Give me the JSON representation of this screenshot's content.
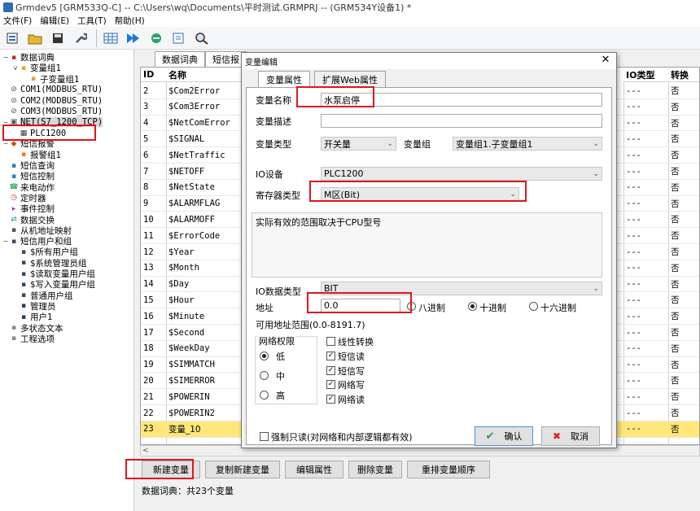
{
  "window": {
    "title": "Grmdev5 [GRM533Q-C]  -- C:\\Users\\wq\\Documents\\平时测试.GRMPRJ -- (GRM534Y设备1) *"
  },
  "menu": [
    "文件(F)",
    "编辑(E)",
    "工具(T)",
    "帮助(H)"
  ],
  "toolbar_icons": [
    "new-project-icon",
    "open-folder-icon",
    "save-icon",
    "wrench-icon",
    "grid-icon",
    "play-icon",
    "sync-icon",
    "export-icon",
    "search-icon"
  ],
  "tree": [
    {
      "label": "数据词典",
      "icon": "book-icon",
      "expander": "−",
      "indent": 0
    },
    {
      "label": "变量组1",
      "icon": "folder-icon",
      "expander": "v",
      "indent": 1
    },
    {
      "label": "子变量组1",
      "icon": "folder-icon",
      "expander": "",
      "indent": 2
    },
    {
      "label": "COM1(MODBUS_RTU)",
      "icon": "link-icon",
      "expander": "",
      "indent": 0
    },
    {
      "label": "COM2(MODBUS_RTU)",
      "icon": "link-icon",
      "expander": "",
      "indent": 0
    },
    {
      "label": "COM3(MODBUS_RTU)",
      "icon": "link-icon",
      "expander": "",
      "indent": 0
    },
    {
      "label": "NET(S7_1200_TCP)",
      "icon": "network-icon",
      "expander": "−",
      "indent": 0,
      "selected": true
    },
    {
      "label": "PLC1200",
      "icon": "device-icon",
      "expander": "",
      "indent": 1
    },
    {
      "label": "短信报警",
      "icon": "alarm-icon",
      "expander": "−",
      "indent": 0
    },
    {
      "label": "报警组1",
      "icon": "alarm-group-icon",
      "expander": "",
      "indent": 1
    },
    {
      "label": "短信查询",
      "icon": "sms-icon",
      "expander": "",
      "indent": 0
    },
    {
      "label": "短信控制",
      "icon": "sms-icon",
      "expander": "",
      "indent": 0
    },
    {
      "label": "来电动作",
      "icon": "phone-icon",
      "expander": "",
      "indent": 0
    },
    {
      "label": "定时器",
      "icon": "clock-icon",
      "expander": "",
      "indent": 0
    },
    {
      "label": "事件控制",
      "icon": "event-icon",
      "expander": "",
      "indent": 0
    },
    {
      "label": "数据交换",
      "icon": "exchange-icon",
      "expander": "",
      "indent": 0
    },
    {
      "label": "从机地址映射",
      "icon": "mapping-icon",
      "expander": "",
      "indent": 0
    },
    {
      "label": "短信用户和组",
      "icon": "users-icon",
      "expander": "−",
      "indent": 0
    },
    {
      "label": "$所有用户组",
      "icon": "group-icon",
      "expander": "",
      "indent": 1
    },
    {
      "label": "$系统管理员组",
      "icon": "group-icon",
      "expander": "",
      "indent": 1
    },
    {
      "label": "$读取变量用户组",
      "icon": "group-icon",
      "expander": "",
      "indent": 1
    },
    {
      "label": "$写入变量用户组",
      "icon": "group-icon",
      "expander": "",
      "indent": 1
    },
    {
      "label": "普通用户组",
      "icon": "group-icon",
      "expander": "",
      "indent": 1
    },
    {
      "label": "管理员",
      "icon": "user-icon",
      "expander": "",
      "indent": 1
    },
    {
      "label": "用户1",
      "icon": "user-icon",
      "expander": "",
      "indent": 1
    },
    {
      "label": "多状态文本",
      "icon": "text-icon",
      "expander": "",
      "indent": 0
    },
    {
      "label": "工程选项",
      "icon": "options-icon",
      "expander": "",
      "indent": 0
    }
  ],
  "tabs": [
    "数据词典",
    "短信报"
  ],
  "grid": {
    "headers": {
      "id": "ID",
      "name": "名称",
      "io_type": "IO类型",
      "swap": "转换"
    },
    "rows": [
      {
        "id": "2",
        "name": "$Com2Error",
        "io": "---",
        "swap": "否"
      },
      {
        "id": "3",
        "name": "$Com3Error",
        "io": "---",
        "swap": "否"
      },
      {
        "id": "4",
        "name": "$NetComError",
        "io": "---",
        "swap": "否"
      },
      {
        "id": "5",
        "name": "$SIGNAL",
        "io": "---",
        "swap": "否"
      },
      {
        "id": "6",
        "name": "$NetTraffic",
        "io": "---",
        "swap": "否"
      },
      {
        "id": "7",
        "name": "$NETOFF",
        "io": "---",
        "swap": "否"
      },
      {
        "id": "8",
        "name": "$NetState",
        "io": "---",
        "swap": "否"
      },
      {
        "id": "9",
        "name": "$ALARMFLAG",
        "io": "---",
        "swap": "否"
      },
      {
        "id": "10",
        "name": "$ALARMOFF",
        "io": "---",
        "swap": "否"
      },
      {
        "id": "11",
        "name": "$ErrorCode",
        "io": "---",
        "swap": "否"
      },
      {
        "id": "12",
        "name": "$Year",
        "io": "---",
        "swap": "否"
      },
      {
        "id": "13",
        "name": "$Month",
        "io": "---",
        "swap": "否"
      },
      {
        "id": "14",
        "name": "$Day",
        "io": "---",
        "swap": "否"
      },
      {
        "id": "15",
        "name": "$Hour",
        "io": "---",
        "swap": "否"
      },
      {
        "id": "16",
        "name": "$Minute",
        "io": "---",
        "swap": "否"
      },
      {
        "id": "17",
        "name": "$Second",
        "io": "---",
        "swap": "否"
      },
      {
        "id": "18",
        "name": "$WeekDay",
        "io": "---",
        "swap": "否"
      },
      {
        "id": "19",
        "name": "$SIMMATCH",
        "io": "---",
        "swap": "否"
      },
      {
        "id": "20",
        "name": "$SIMERROR",
        "io": "---",
        "swap": "否"
      },
      {
        "id": "21",
        "name": "$POWERIN",
        "io": "---",
        "swap": "否"
      },
      {
        "id": "22",
        "name": "$POWERIN2",
        "io": "---",
        "swap": "否"
      },
      {
        "id": "23",
        "name": "变量_10",
        "io": "---",
        "swap": "否",
        "highlight": true
      }
    ]
  },
  "buttons": {
    "new_var": "新建变量",
    "copy_new": "复制新建变量",
    "edit_props": "编辑属性",
    "delete_var": "删除变量",
    "reorder": "重排变量顺序"
  },
  "status": "数据词典：共23个变量",
  "dialog": {
    "title": "变量编辑",
    "close": "✕",
    "tabs": [
      "变量属性",
      "扩展Web属性"
    ],
    "var_name_label": "变量名称",
    "var_name_value": "水泵启停",
    "var_desc_label": "变量描述",
    "var_desc_value": "",
    "var_type_label": "变量类型",
    "var_type_value": "开关量",
    "var_group_label": "变量组",
    "var_group_value": "变量组1.子变量组1",
    "io_device_label": "IO设备",
    "io_device_value": "PLC1200",
    "reg_type_label": "寄存器类型",
    "reg_type_value": "M区(Bit)",
    "info_text": "实际有效的范围取决于CPU型号",
    "io_data_type_label": "IO数据类型",
    "io_data_type_value": "BIT",
    "address_label": "地址",
    "address_value": "0.0",
    "radix": {
      "oct": "八进制",
      "dec": "十进制",
      "hex": "十六进制"
    },
    "range_text": "可用地址范围(0.0-8191.7)",
    "net_perm_label": "网络权限",
    "perm": {
      "low": "低",
      "mid": "中",
      "high": "高"
    },
    "checks": {
      "linear": "线性转换",
      "sms_read": "短信读",
      "sms_write": "短信写",
      "net_write": "网络写",
      "net_read": "网络读"
    },
    "force_readonly": "强制只读(对网络和内部逻辑都有效)",
    "ok": "确认",
    "cancel": "取消"
  }
}
